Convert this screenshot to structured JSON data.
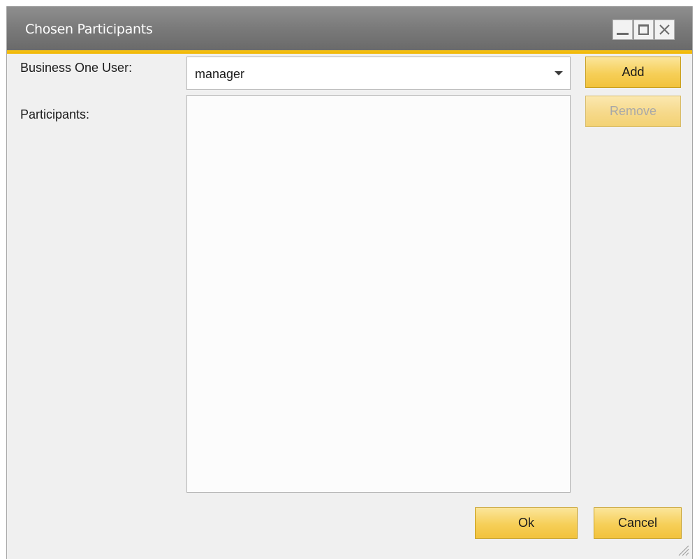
{
  "window": {
    "title": "Chosen Participants"
  },
  "form": {
    "user_label": "Business One User:",
    "user_value": "manager",
    "participants_label": "Participants:",
    "participants": []
  },
  "buttons": {
    "add": "Add",
    "remove": "Remove",
    "ok": "Ok",
    "cancel": "Cancel"
  },
  "colors": {
    "accent": "#f0b400",
    "titlebar": "#7a7a7a",
    "button": "#f6cf58"
  }
}
